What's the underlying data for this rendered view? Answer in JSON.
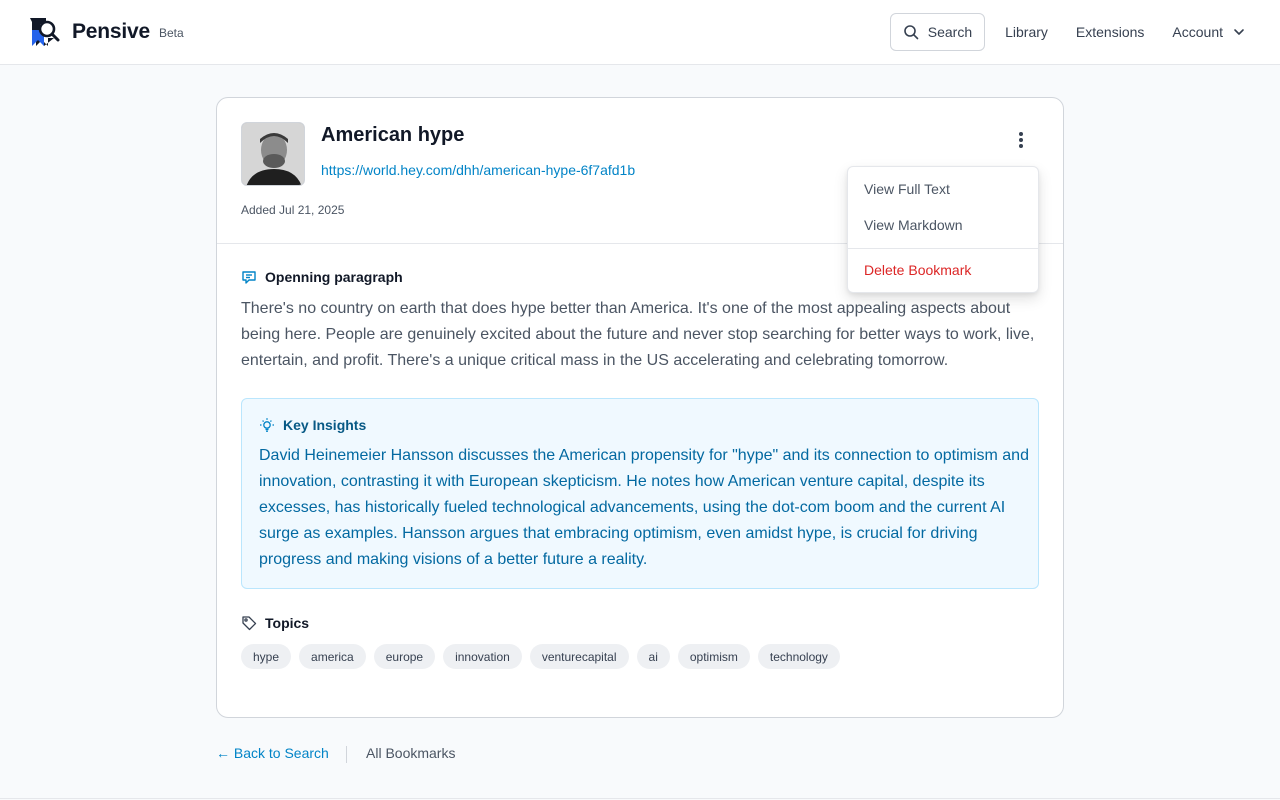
{
  "header": {
    "brand_name": "Pensive",
    "brand_badge": "Beta",
    "search_label": "Search",
    "nav": [
      "Library",
      "Extensions"
    ],
    "account_label": "Account"
  },
  "bookmark": {
    "title": "American hype",
    "url": "https://world.hey.com/dhh/american-hype-6f7afd1b",
    "added": "Added Jul 21, 2025",
    "opening_label": "Openning paragraph",
    "opening_text": "There's no country on earth that does hype better than America. It's one of the most appealing aspects about being here. People are genuinely excited about the future and never stop searching for better ways to work, live, entertain, and profit. There's a unique critical mass in the US accelerating and celebrating tomorrow.",
    "insights_label": "Key Insights",
    "insights_text": "David Heinemeier Hansson discusses the American propensity for \"hype\" and its connection to optimism and innovation, contrasting it with European skepticism. He notes how American venture capital, despite its excesses, has historically fueled technological advancements, using the dot-com boom and the current AI surge as examples. Hansson argues that embracing optimism, even amidst hype, is crucial for driving progress and making visions of a better future a reality.",
    "topics_label": "Topics",
    "topics": [
      "hype",
      "america",
      "europe",
      "innovation",
      "venturecapital",
      "ai",
      "optimism",
      "technology"
    ]
  },
  "menu": {
    "view_full_text": "View Full Text",
    "view_markdown": "View Markdown",
    "delete_bookmark": "Delete Bookmark"
  },
  "footer": {
    "back_label": "← Back to Search",
    "all_bookmarks_label": "All Bookmarks"
  },
  "colors": {
    "accent": "#0284c7",
    "danger": "#dc2626",
    "insights_bg": "#f0f9ff",
    "insights_text": "#0369a1"
  }
}
